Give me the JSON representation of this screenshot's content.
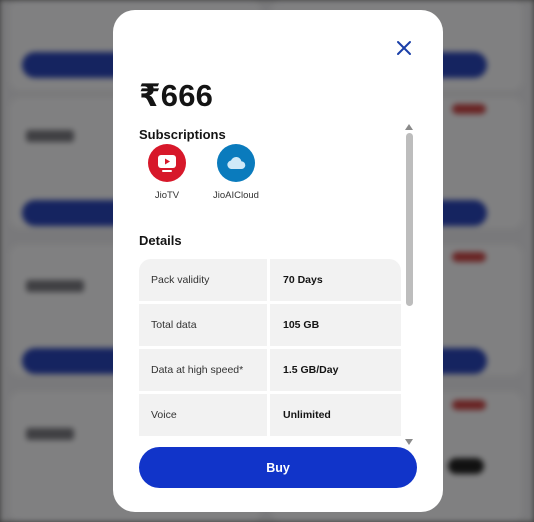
{
  "modal": {
    "price": "₹666",
    "subscriptions_title": "Subscriptions",
    "subscriptions": [
      {
        "name": "JioTV",
        "icon": "jiotv-icon",
        "color": "#d7182a"
      },
      {
        "name": "JioAICloud",
        "icon": "cloud-icon",
        "color": "#0a7bbd"
      }
    ],
    "details_title": "Details",
    "details": [
      {
        "label": "Pack validity",
        "value": "70 Days"
      },
      {
        "label": "Total data",
        "value": "105 GB"
      },
      {
        "label": "Data at high speed*",
        "value": "1.5 GB/Day"
      },
      {
        "label": "Voice",
        "value": "Unlimited"
      }
    ],
    "buy_label": "Buy"
  },
  "colors": {
    "accent": "#1134c9",
    "close_icon": "#1a3fa8"
  }
}
